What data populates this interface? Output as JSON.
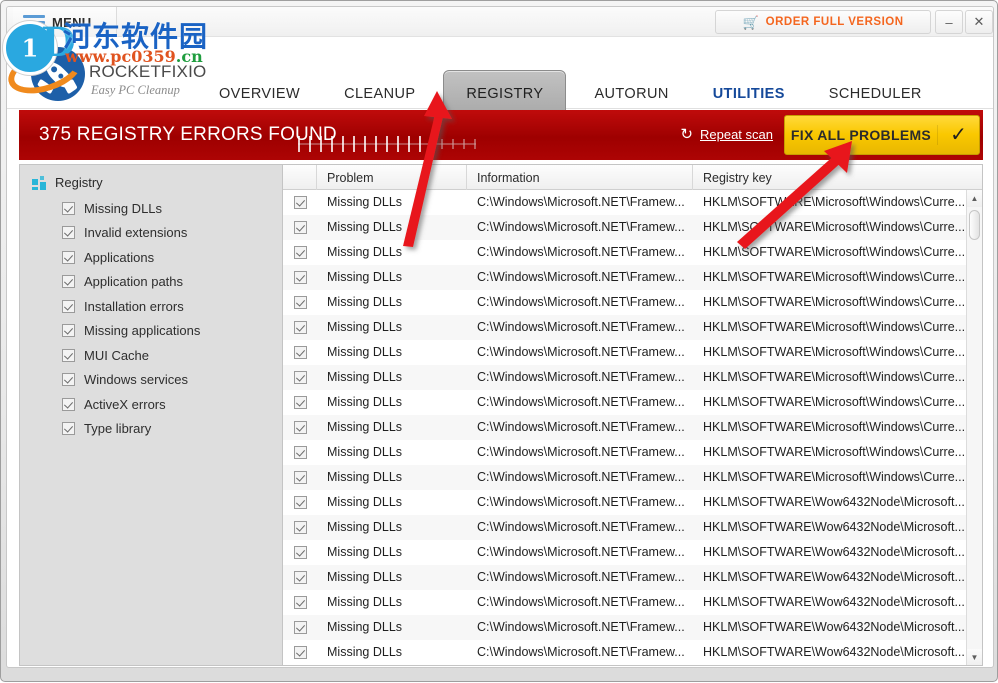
{
  "window": {
    "menu_label": "MENU",
    "order_label": "ORDER FULL VERSION",
    "minimize_label": "–",
    "close_label": "✕"
  },
  "logo": {
    "name": "ROCKETFIXIO",
    "tagline": "Easy PC Cleanup"
  },
  "nav": {
    "tabs": [
      {
        "label": "OVERVIEW",
        "state": "normal"
      },
      {
        "label": "CLEANUP",
        "state": "normal"
      },
      {
        "label": "REGISTRY",
        "state": "active"
      },
      {
        "label": "AUTORUN",
        "state": "normal"
      },
      {
        "label": "UTILITIES",
        "state": "highlight"
      },
      {
        "label": "SCHEDULER",
        "state": "normal"
      }
    ]
  },
  "alert": {
    "title": "375 REGISTRY ERRORS FOUND",
    "error_count": 375,
    "repeat_scan_label": "Repeat scan",
    "repeat_scan_icon": "refresh-icon",
    "fix_all_label": "FIX ALL PROBLEMS",
    "fix_all_check": "✓",
    "background_color": "#a80404",
    "fix_button_color": "#fac800",
    "ruler_ticks_total": 17,
    "ruler_ticks_filled": 13
  },
  "sidebar": {
    "root_label": "Registry",
    "root_icon": "grid-icon",
    "items": [
      {
        "label": "Missing DLLs",
        "checked": true
      },
      {
        "label": "Invalid extensions",
        "checked": true
      },
      {
        "label": "Applications",
        "checked": true
      },
      {
        "label": "Application paths",
        "checked": true
      },
      {
        "label": "Installation errors",
        "checked": true
      },
      {
        "label": "Missing applications",
        "checked": true
      },
      {
        "label": "MUI Cache",
        "checked": true
      },
      {
        "label": "Windows services",
        "checked": true
      },
      {
        "label": "ActiveX errors",
        "checked": true
      },
      {
        "label": "Type library",
        "checked": true
      }
    ]
  },
  "table": {
    "columns": [
      "",
      "Problem",
      "Information",
      "Registry key"
    ],
    "rows": [
      {
        "checked": true,
        "problem": "Missing DLLs",
        "information": "C:\\Windows\\Microsoft.NET\\Framew...",
        "registry_key": "HKLM\\SOFTWARE\\Microsoft\\Windows\\Curre..."
      },
      {
        "checked": true,
        "problem": "Missing DLLs",
        "information": "C:\\Windows\\Microsoft.NET\\Framew...",
        "registry_key": "HKLM\\SOFTWARE\\Microsoft\\Windows\\Curre..."
      },
      {
        "checked": true,
        "problem": "Missing DLLs",
        "information": "C:\\Windows\\Microsoft.NET\\Framew...",
        "registry_key": "HKLM\\SOFTWARE\\Microsoft\\Windows\\Curre..."
      },
      {
        "checked": true,
        "problem": "Missing DLLs",
        "information": "C:\\Windows\\Microsoft.NET\\Framew...",
        "registry_key": "HKLM\\SOFTWARE\\Microsoft\\Windows\\Curre..."
      },
      {
        "checked": true,
        "problem": "Missing DLLs",
        "information": "C:\\Windows\\Microsoft.NET\\Framew...",
        "registry_key": "HKLM\\SOFTWARE\\Microsoft\\Windows\\Curre..."
      },
      {
        "checked": true,
        "problem": "Missing DLLs",
        "information": "C:\\Windows\\Microsoft.NET\\Framew...",
        "registry_key": "HKLM\\SOFTWARE\\Microsoft\\Windows\\Curre..."
      },
      {
        "checked": true,
        "problem": "Missing DLLs",
        "information": "C:\\Windows\\Microsoft.NET\\Framew...",
        "registry_key": "HKLM\\SOFTWARE\\Microsoft\\Windows\\Curre..."
      },
      {
        "checked": true,
        "problem": "Missing DLLs",
        "information": "C:\\Windows\\Microsoft.NET\\Framew...",
        "registry_key": "HKLM\\SOFTWARE\\Microsoft\\Windows\\Curre..."
      },
      {
        "checked": true,
        "problem": "Missing DLLs",
        "information": "C:\\Windows\\Microsoft.NET\\Framew...",
        "registry_key": "HKLM\\SOFTWARE\\Microsoft\\Windows\\Curre..."
      },
      {
        "checked": true,
        "problem": "Missing DLLs",
        "information": "C:\\Windows\\Microsoft.NET\\Framew...",
        "registry_key": "HKLM\\SOFTWARE\\Microsoft\\Windows\\Curre..."
      },
      {
        "checked": true,
        "problem": "Missing DLLs",
        "information": "C:\\Windows\\Microsoft.NET\\Framew...",
        "registry_key": "HKLM\\SOFTWARE\\Microsoft\\Windows\\Curre..."
      },
      {
        "checked": true,
        "problem": "Missing DLLs",
        "information": "C:\\Windows\\Microsoft.NET\\Framew...",
        "registry_key": "HKLM\\SOFTWARE\\Microsoft\\Windows\\Curre..."
      },
      {
        "checked": true,
        "problem": "Missing DLLs",
        "information": "C:\\Windows\\Microsoft.NET\\Framew...",
        "registry_key": "HKLM\\SOFTWARE\\Wow6432Node\\Microsoft..."
      },
      {
        "checked": true,
        "problem": "Missing DLLs",
        "information": "C:\\Windows\\Microsoft.NET\\Framew...",
        "registry_key": "HKLM\\SOFTWARE\\Wow6432Node\\Microsoft..."
      },
      {
        "checked": true,
        "problem": "Missing DLLs",
        "information": "C:\\Windows\\Microsoft.NET\\Framew...",
        "registry_key": "HKLM\\SOFTWARE\\Wow6432Node\\Microsoft..."
      },
      {
        "checked": true,
        "problem": "Missing DLLs",
        "information": "C:\\Windows\\Microsoft.NET\\Framew...",
        "registry_key": "HKLM\\SOFTWARE\\Wow6432Node\\Microsoft..."
      },
      {
        "checked": true,
        "problem": "Missing DLLs",
        "information": "C:\\Windows\\Microsoft.NET\\Framew...",
        "registry_key": "HKLM\\SOFTWARE\\Wow6432Node\\Microsoft..."
      },
      {
        "checked": true,
        "problem": "Missing DLLs",
        "information": "C:\\Windows\\Microsoft.NET\\Framew...",
        "registry_key": "HKLM\\SOFTWARE\\Wow6432Node\\Microsoft..."
      },
      {
        "checked": true,
        "problem": "Missing DLLs",
        "information": "C:\\Windows\\Microsoft.NET\\Framew...",
        "registry_key": "HKLM\\SOFTWARE\\Wow6432Node\\Microsoft..."
      }
    ]
  },
  "scrollbar": {
    "up_arrow": "▲",
    "down_arrow": "▼"
  },
  "watermark": {
    "site_name": "河东软件园",
    "url_main": "www.pc0359",
    "url_tld": ".cn"
  }
}
